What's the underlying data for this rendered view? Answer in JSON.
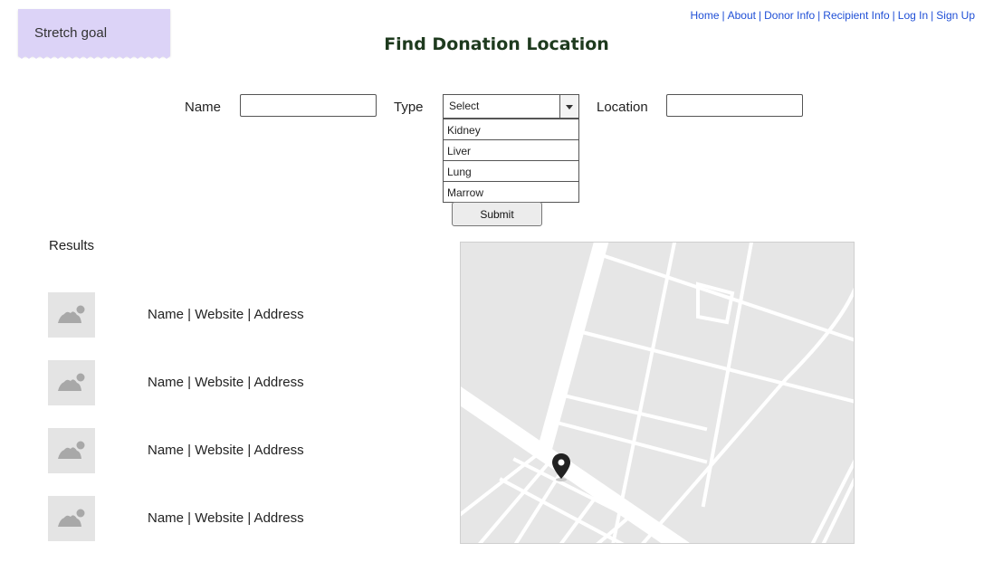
{
  "sticky_note": {
    "text": "Stretch goal"
  },
  "nav": {
    "links": [
      "Home",
      "About",
      "Donor Info",
      "Recipient Info",
      "Log In",
      "Sign Up"
    ],
    "separator": "|"
  },
  "page_title": "Find Donation Location",
  "form": {
    "name_label": "Name",
    "name_value": "",
    "type_label": "Type",
    "type_selected": "Select",
    "type_options": [
      "Kidney",
      "Liver",
      "Lung",
      "Marrow"
    ],
    "location_label": "Location",
    "location_value": "",
    "submit_label": "Submit"
  },
  "results": {
    "label": "Results",
    "items": [
      {
        "text": "Name | Website | Address",
        "icon": "image-placeholder-icon"
      },
      {
        "text": "Name | Website | Address",
        "icon": "image-placeholder-icon"
      },
      {
        "text": "Name | Website | Address",
        "icon": "image-placeholder-icon"
      },
      {
        "text": "Name | Website | Address",
        "icon": "image-placeholder-icon"
      }
    ]
  },
  "map": {
    "marker_icon": "map-pin-icon"
  },
  "colors": {
    "sticky": "#dcd3f7",
    "link": "#1f4fd6",
    "title": "#1e3a1e",
    "map_bg": "#e6e6e6",
    "thumb_bg": "#e4e4e4"
  }
}
